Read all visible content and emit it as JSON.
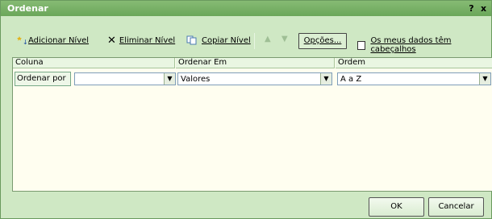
{
  "window": {
    "title": "Ordenar",
    "help": "?",
    "close": "x"
  },
  "toolbar": {
    "add_level": "Adicionar Nível",
    "delete_level": "Eliminar Nível",
    "copy_level": "Copiar Nível",
    "options": "Opções...",
    "headers_checkbox": "Os meus dados têm cabeçalhos"
  },
  "grid": {
    "columns": [
      "Coluna",
      "Ordenar Em",
      "Ordem"
    ],
    "row": {
      "label": "Ordenar por",
      "column_value": "",
      "sort_on": "Valores",
      "order": "A a Z"
    }
  },
  "buttons": {
    "ok": "OK",
    "cancel": "Cancelar"
  },
  "colors": {
    "background": "#cfe8c4",
    "titlebar": "#6ba65a"
  }
}
